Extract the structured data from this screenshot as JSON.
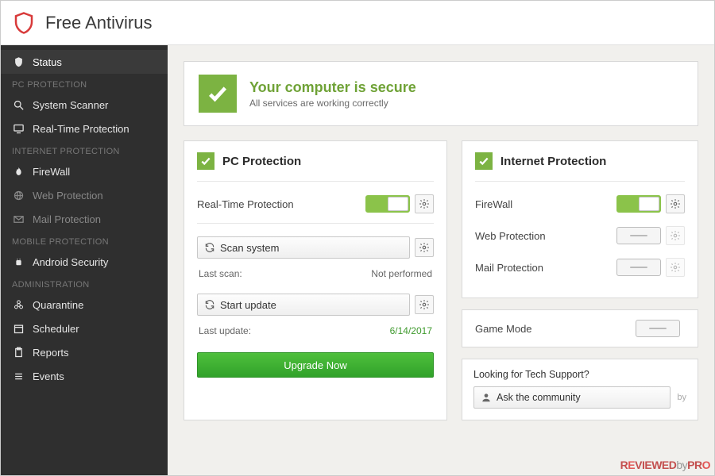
{
  "header": {
    "title": "Free Antivirus"
  },
  "sidebar": {
    "sections": [
      {
        "heading": null,
        "items": [
          {
            "icon": "shield-icon",
            "label": "Status",
            "active": true,
            "dim": false
          }
        ]
      },
      {
        "heading": "PC PROTECTION",
        "items": [
          {
            "icon": "search-icon",
            "label": "System Scanner",
            "active": false,
            "dim": false
          },
          {
            "icon": "monitor-icon",
            "label": "Real-Time Protection",
            "active": false,
            "dim": false
          }
        ]
      },
      {
        "heading": "INTERNET PROTECTION",
        "items": [
          {
            "icon": "flame-icon",
            "label": "FireWall",
            "active": false,
            "dim": false
          },
          {
            "icon": "globe-icon",
            "label": "Web Protection",
            "active": false,
            "dim": true
          },
          {
            "icon": "mail-icon",
            "label": "Mail Protection",
            "active": false,
            "dim": true
          }
        ]
      },
      {
        "heading": "MOBILE PROTECTION",
        "items": [
          {
            "icon": "android-icon",
            "label": "Android Security",
            "active": false,
            "dim": false
          }
        ]
      },
      {
        "heading": "ADMINISTRATION",
        "items": [
          {
            "icon": "biohazard-icon",
            "label": "Quarantine",
            "active": false,
            "dim": false
          },
          {
            "icon": "calendar-icon",
            "label": "Scheduler",
            "active": false,
            "dim": false
          },
          {
            "icon": "clipboard-icon",
            "label": "Reports",
            "active": false,
            "dim": false
          },
          {
            "icon": "list-icon",
            "label": "Events",
            "active": false,
            "dim": false
          }
        ]
      }
    ]
  },
  "status": {
    "title": "Your computer is secure",
    "subtitle": "All services are working correctly"
  },
  "pc_panel": {
    "title": "PC Protection",
    "realtime_label": "Real-Time Protection",
    "realtime_on": true,
    "scan_btn": "Scan system",
    "scan_meta_label": "Last scan:",
    "scan_meta_value": "Not performed",
    "update_btn": "Start update",
    "update_meta_label": "Last update:",
    "update_meta_value": "6/14/2017",
    "upgrade_btn": "Upgrade Now"
  },
  "net_panel": {
    "title": "Internet Protection",
    "rows": [
      {
        "label": "FireWall",
        "state": "on",
        "gear_enabled": true
      },
      {
        "label": "Web Protection",
        "state": "dash",
        "gear_enabled": false
      },
      {
        "label": "Mail Protection",
        "state": "dash",
        "gear_enabled": false
      }
    ]
  },
  "game_panel": {
    "label": "Game Mode",
    "state": "dash"
  },
  "support": {
    "question": "Looking for Tech Support?",
    "ask_btn": "Ask the community",
    "by": "by"
  },
  "watermark": "REVIEWEDbyPRO"
}
